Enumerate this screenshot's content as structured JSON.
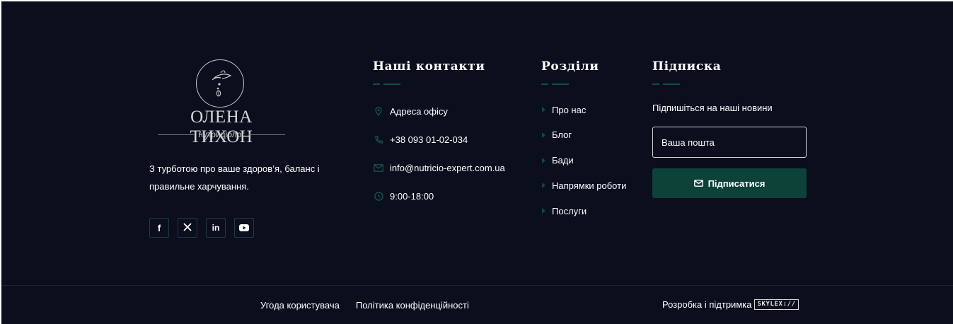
{
  "colors": {
    "background": "#0b0e1d",
    "accent": "#0d4239",
    "accent_dark": "#17463f",
    "text": "#ffffff"
  },
  "brand": {
    "logo_name": "ОЛЕНА ТИХОН",
    "logo_subtitle": "нутриціолог",
    "tagline": "З турботою про ваше здоров’я, баланс і правильне харчування.",
    "socials": [
      {
        "icon": "facebook-icon",
        "glyph": "f"
      },
      {
        "icon": "x-twitter-icon",
        "glyph": "𝕏"
      },
      {
        "icon": "linkedin-icon",
        "glyph": "in"
      },
      {
        "icon": "youtube-icon",
        "glyph": "▶"
      }
    ]
  },
  "contacts": {
    "title": "Наші контакти",
    "items": [
      {
        "icon": "map-pin-icon",
        "text": "Адреса офісу"
      },
      {
        "icon": "phone-icon",
        "text": "+38 093 01-02-034"
      },
      {
        "icon": "mail-icon",
        "text": "info@nutricio-expert.com.ua"
      },
      {
        "icon": "clock-icon",
        "text": "9:00-18:00"
      }
    ]
  },
  "sections": {
    "title": "Розділи",
    "items": [
      "Про нас",
      "Блог",
      "Бади",
      "Напрямки роботи",
      "Послуги"
    ]
  },
  "subscribe": {
    "title": "Підписка",
    "text": "Підпишіться на наші новини",
    "email_placeholder": "Ваша пошта",
    "button_label": "Підписатися"
  },
  "bottom": {
    "links": [
      "Угода користувача",
      "Політика конфіденційності"
    ],
    "developer_label": "Розробка і підтримка",
    "developer_badge": "SKYLEX://"
  }
}
